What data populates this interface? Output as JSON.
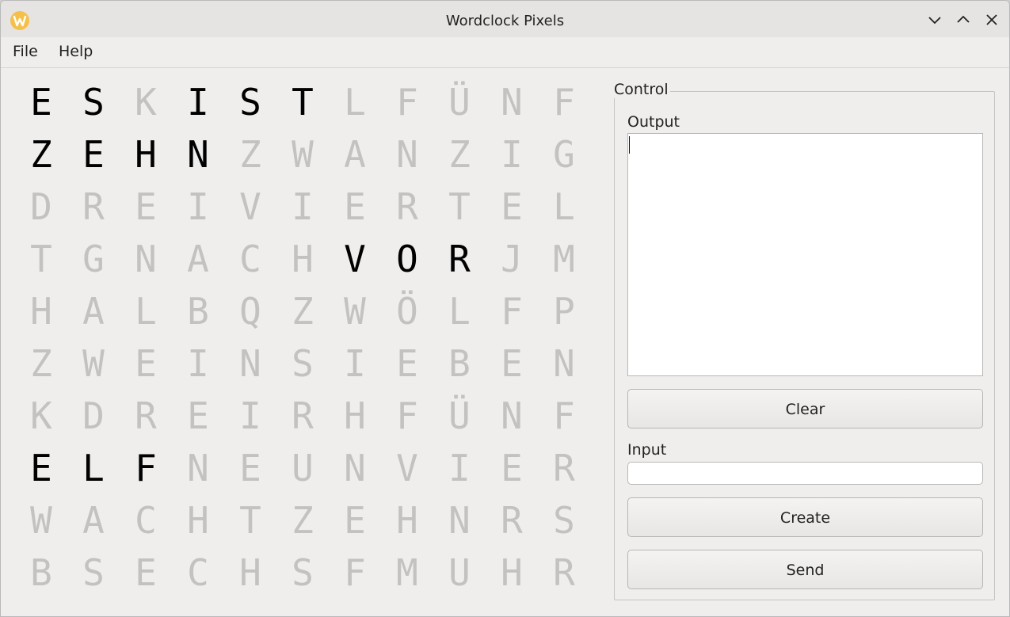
{
  "window": {
    "title": "Wordclock Pixels"
  },
  "menu": {
    "items": [
      "File",
      "Help"
    ]
  },
  "clock": {
    "rows": [
      [
        "E",
        "S",
        "K",
        "I",
        "S",
        "T",
        "L",
        "F",
        "Ü",
        "N",
        "F"
      ],
      [
        "Z",
        "E",
        "H",
        "N",
        "Z",
        "W",
        "A",
        "N",
        "Z",
        "I",
        "G"
      ],
      [
        "D",
        "R",
        "E",
        "I",
        "V",
        "I",
        "E",
        "R",
        "T",
        "E",
        "L"
      ],
      [
        "T",
        "G",
        "N",
        "A",
        "C",
        "H",
        "V",
        "O",
        "R",
        "J",
        "M"
      ],
      [
        "H",
        "A",
        "L",
        "B",
        "Q",
        "Z",
        "W",
        "Ö",
        "L",
        "F",
        "P"
      ],
      [
        "Z",
        "W",
        "E",
        "I",
        "N",
        "S",
        "I",
        "E",
        "B",
        "E",
        "N"
      ],
      [
        "K",
        "D",
        "R",
        "E",
        "I",
        "R",
        "H",
        "F",
        "Ü",
        "N",
        "F"
      ],
      [
        "E",
        "L",
        "F",
        "N",
        "E",
        "U",
        "N",
        "V",
        "I",
        "E",
        "R"
      ],
      [
        "W",
        "A",
        "C",
        "H",
        "T",
        "Z",
        "E",
        "H",
        "N",
        "R",
        "S"
      ],
      [
        "B",
        "S",
        "E",
        "C",
        "H",
        "S",
        "F",
        "M",
        "U",
        "H",
        "R"
      ]
    ],
    "lit": [
      [
        0,
        0
      ],
      [
        0,
        1
      ],
      [
        0,
        3
      ],
      [
        0,
        4
      ],
      [
        0,
        5
      ],
      [
        1,
        0
      ],
      [
        1,
        1
      ],
      [
        1,
        2
      ],
      [
        1,
        3
      ],
      [
        3,
        6
      ],
      [
        3,
        7
      ],
      [
        3,
        8
      ],
      [
        7,
        0
      ],
      [
        7,
        1
      ],
      [
        7,
        2
      ]
    ],
    "lit_color": "#000000",
    "dim_color": "#c3c2c1"
  },
  "control": {
    "title": "Control",
    "output_label": "Output",
    "output_value": "",
    "clear_label": "Clear",
    "input_label": "Input",
    "input_value": "",
    "create_label": "Create",
    "send_label": "Send"
  }
}
